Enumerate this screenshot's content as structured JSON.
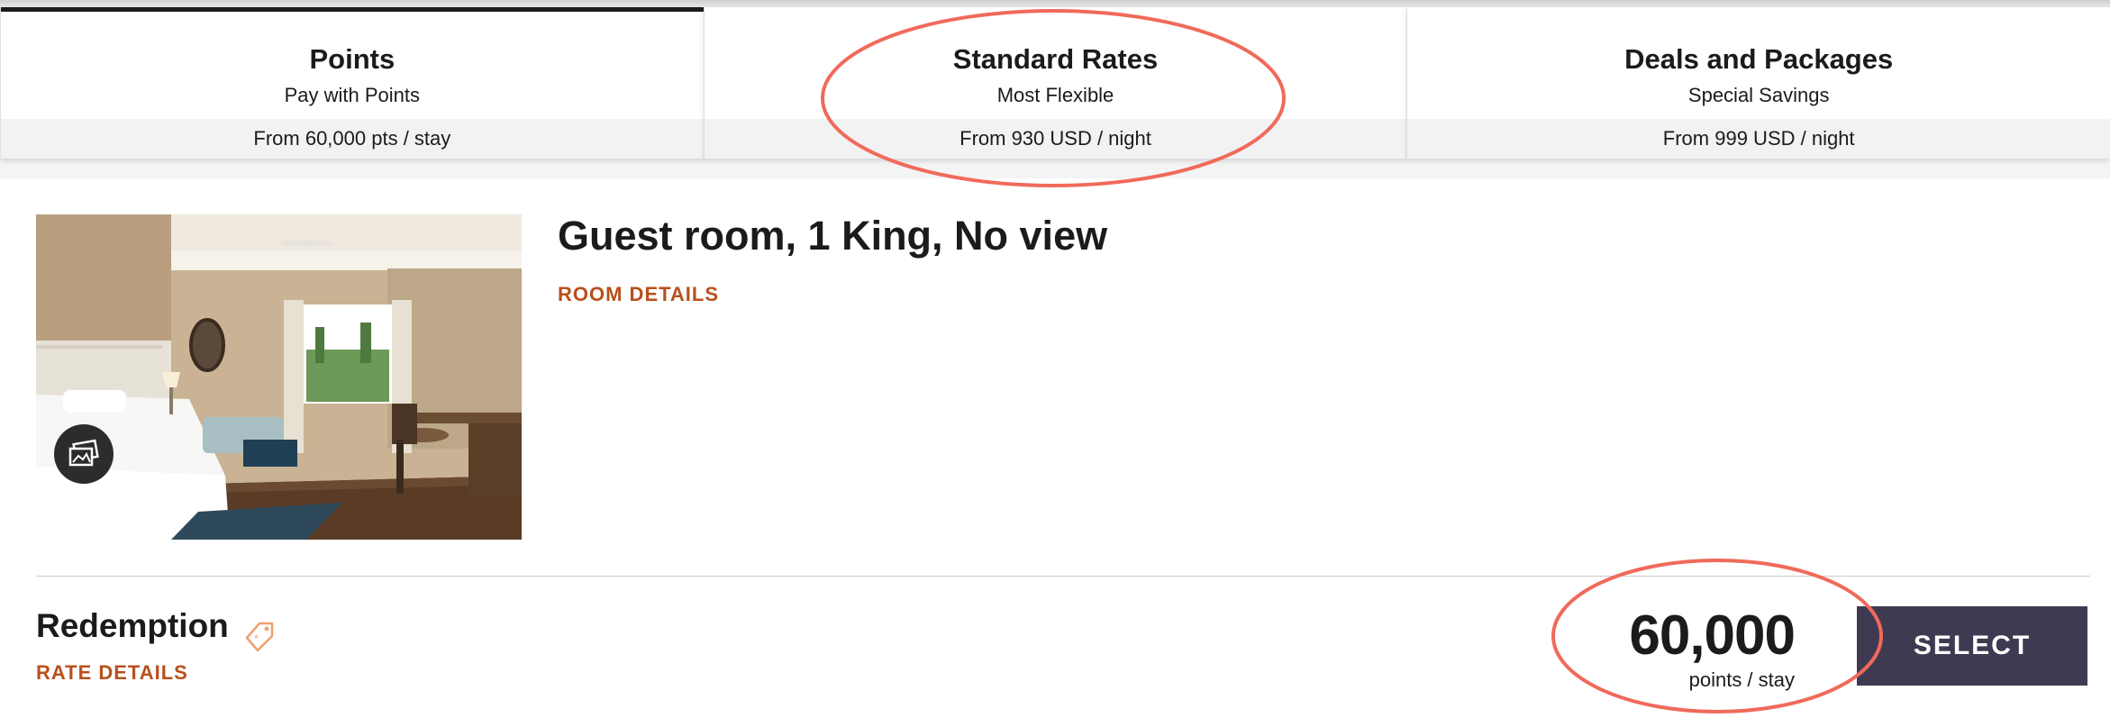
{
  "tabs": [
    {
      "title": "Points",
      "subtitle": "Pay with Points",
      "price": "From 60,000 pts / stay",
      "active": true
    },
    {
      "title": "Standard Rates",
      "subtitle": "Most Flexible",
      "price": "From 930 USD / night",
      "active": false
    },
    {
      "title": "Deals and Packages",
      "subtitle": "Special Savings",
      "price": "From 999 USD / night",
      "active": false
    }
  ],
  "room": {
    "title": "Guest room, 1 King, No view",
    "details_link": "ROOM DETAILS",
    "photo_icon": "gallery-icon"
  },
  "rate": {
    "name": "Redemption",
    "tag_icon": "tag-icon",
    "details_link": "RATE DETAILS",
    "points": "60,000",
    "points_unit": "points / stay",
    "select_label": "SELECT"
  },
  "colors": {
    "accent_link": "#b8501c",
    "select_button": "#3f3a52",
    "annotation_circle": "#f06a5a",
    "tag_icon": "#f0a070"
  }
}
